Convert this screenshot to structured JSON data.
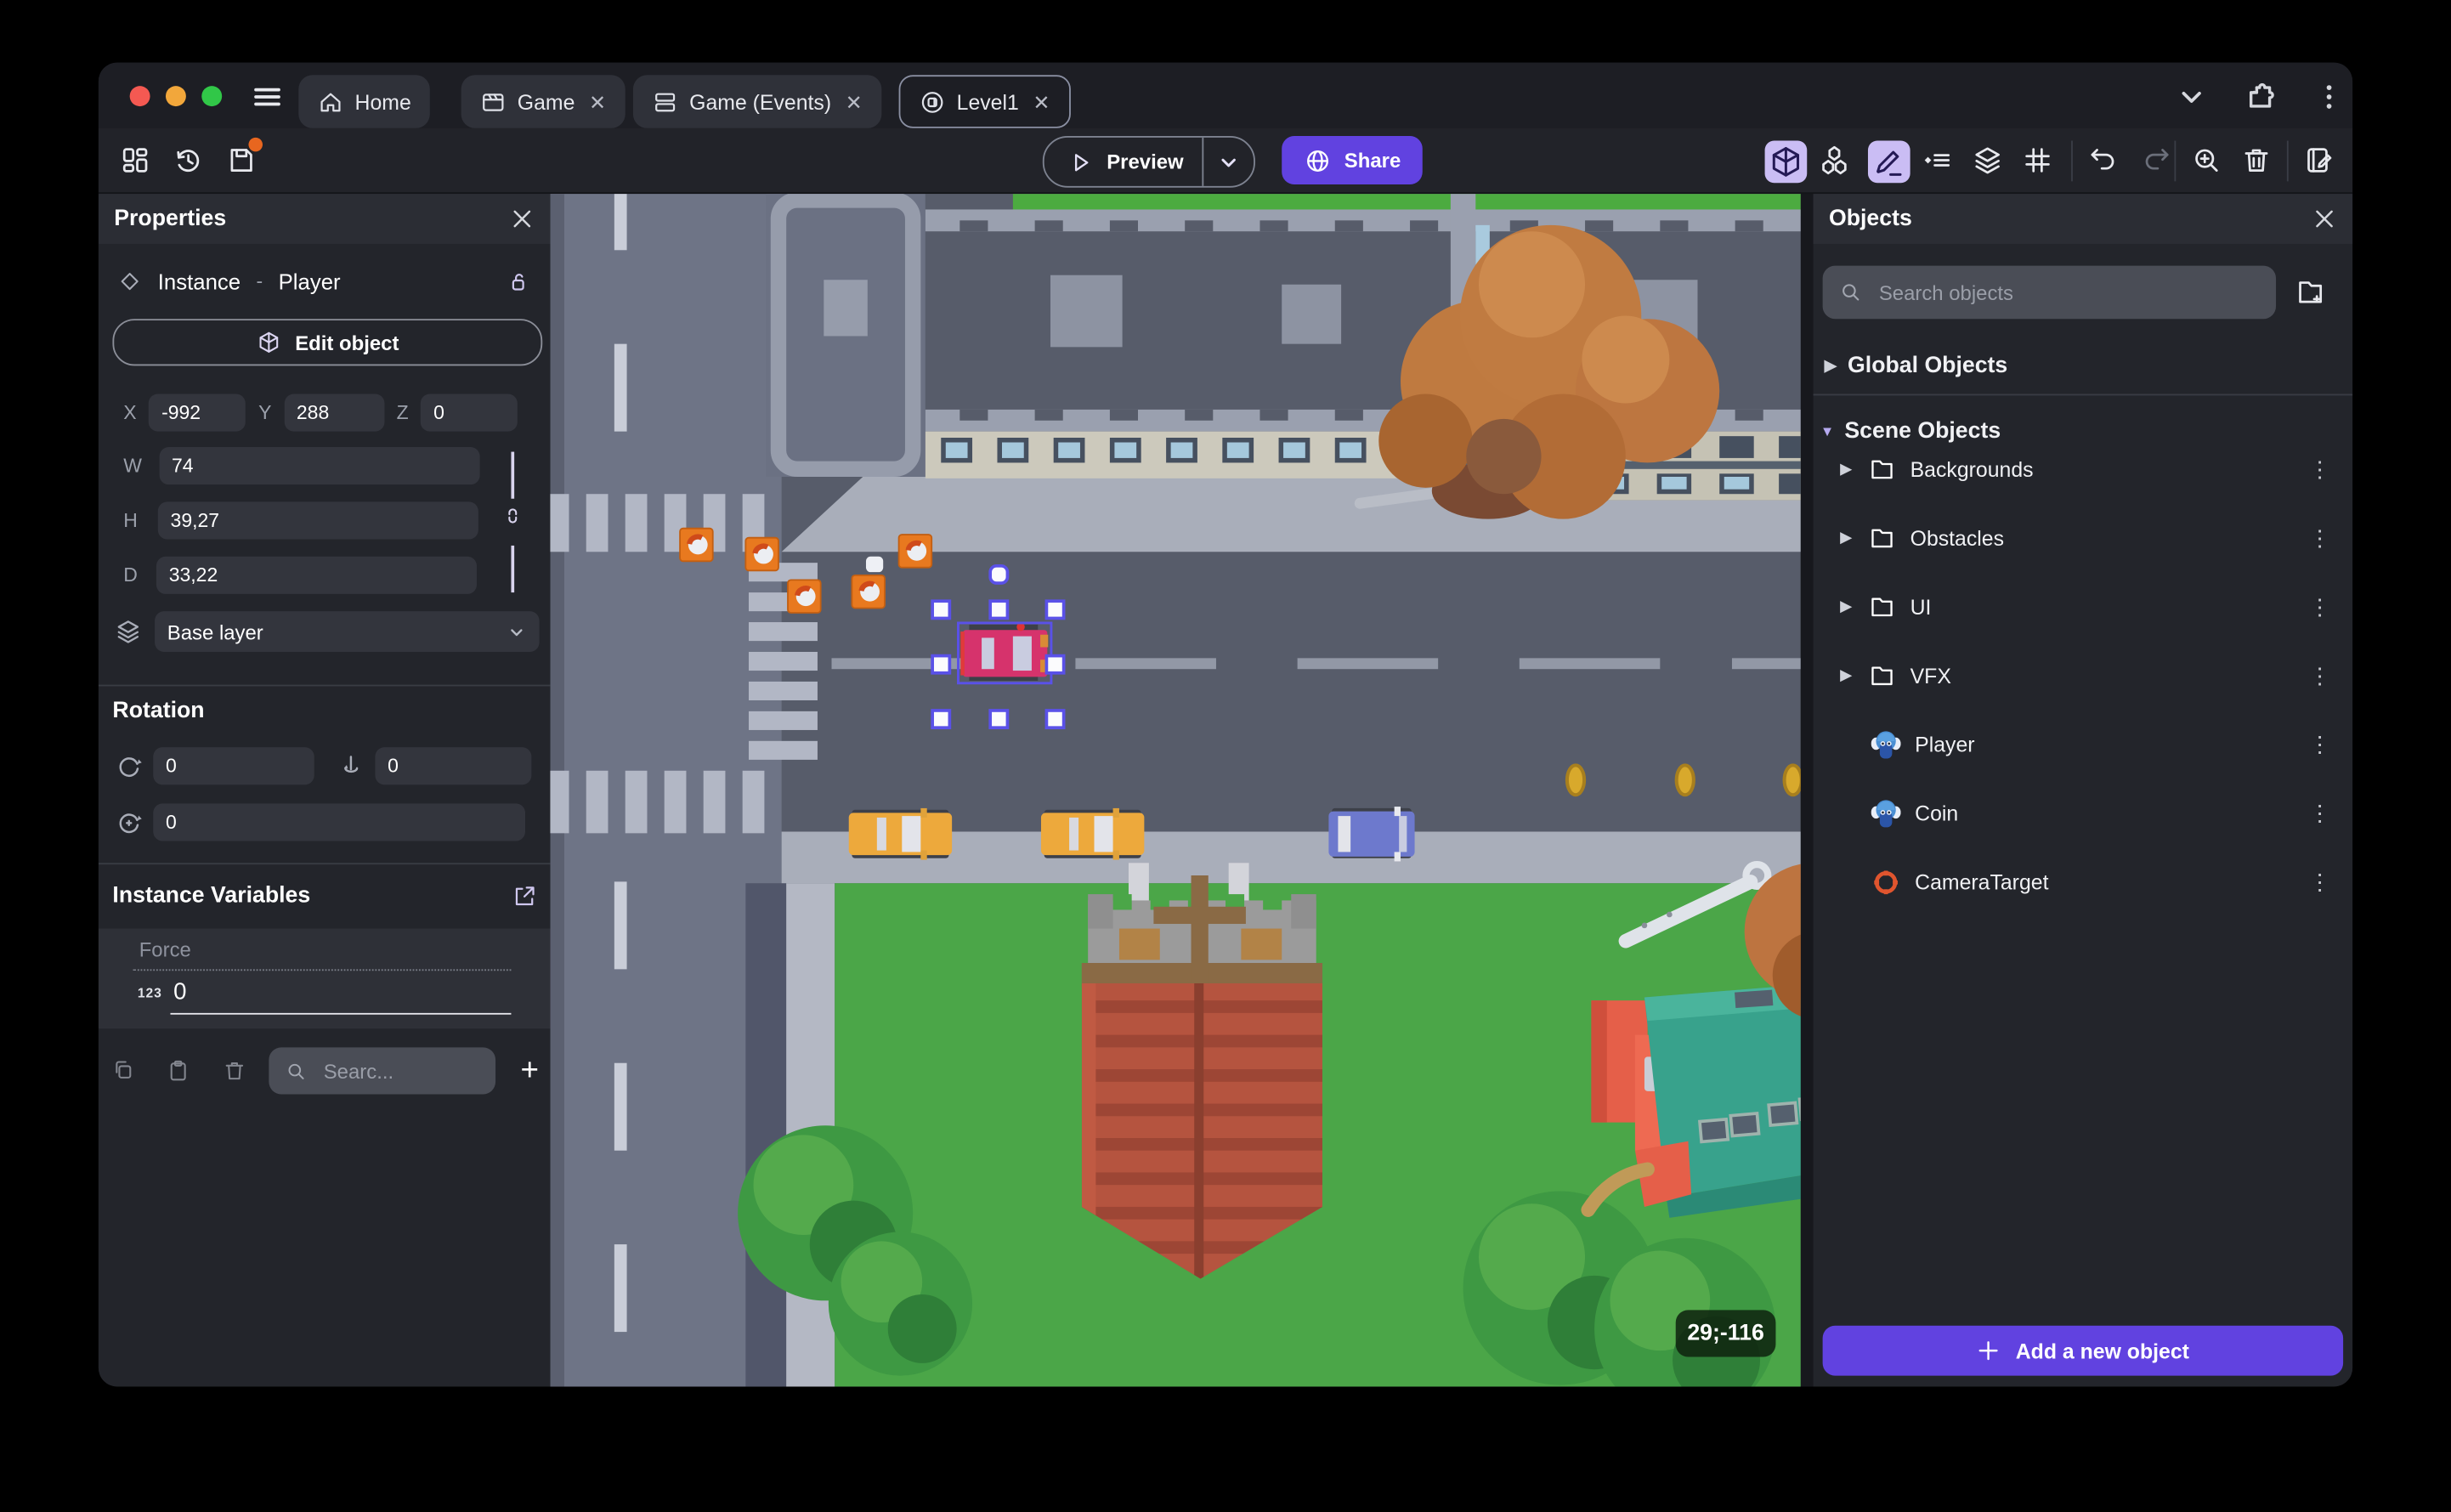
{
  "colors": {
    "accent": "#6142e0",
    "accent_light": "#cabdf4",
    "traffic_red": "#f45952",
    "traffic_yellow": "#f2a73b",
    "traffic_green": "#31c748",
    "save_badge": "#e8661f",
    "selection": "#5a51e8",
    "camera_target_icon": "#e0552e"
  },
  "titlebar": {
    "tabs": [
      {
        "label": "Home",
        "icon": "home-icon",
        "active": false,
        "closable": false
      },
      {
        "label": "Game",
        "icon": "clapper-icon",
        "active": false,
        "closable": true
      },
      {
        "label": "Game (Events)",
        "icon": "events-icon",
        "active": false,
        "closable": true
      },
      {
        "label": "Level1",
        "icon": "scene-icon",
        "active": true,
        "closable": true
      }
    ],
    "close_glyph": "✕"
  },
  "toolbar": {
    "preview_label": "Preview",
    "share_label": "Share",
    "left_icons": [
      "dashboard-icon",
      "history-icon",
      "save-icon"
    ],
    "right_icons": [
      "cube-3d-icon",
      "objects-icon",
      "pencil-icon",
      "instances-list-icon",
      "layers-icon",
      "grid-icon",
      "undo-icon",
      "redo-icon",
      "zoom-in-icon",
      "trash-icon",
      "notebook-edit-icon"
    ]
  },
  "properties": {
    "title": "Properties",
    "instance_type": "Instance",
    "separator": "-",
    "instance_name": "Player",
    "edit_object": "Edit object",
    "x_label": "X",
    "x": "-992",
    "y_label": "Y",
    "y": "288",
    "z_label": "Z",
    "z": "0",
    "w_label": "W",
    "w": "74",
    "h_label": "H",
    "h": "39,27",
    "d_label": "D",
    "d": "33,22",
    "layer": "Base layer",
    "rotation_title": "Rotation",
    "rot_x": "0",
    "rot_y": "0",
    "rot_z": "0",
    "variables_title": "Instance Variables",
    "var_name": "Force",
    "var_type": "123",
    "var_value": "0",
    "search_placeholder": "Searc...",
    "add_glyph": "+"
  },
  "objects_panel": {
    "title": "Objects",
    "search_placeholder": "Search objects",
    "global_group": "Global Objects",
    "scene_group": "Scene Objects",
    "folders": [
      {
        "label": "Backgrounds"
      },
      {
        "label": "Obstacles"
      },
      {
        "label": "UI"
      },
      {
        "label": "VFX"
      }
    ],
    "items": [
      {
        "label": "Player",
        "icon": "monkey-icon"
      },
      {
        "label": "Coin",
        "icon": "monkey-icon"
      },
      {
        "label": "CameraTarget",
        "icon": "target-icon"
      }
    ],
    "add_button": "Add a new object",
    "kebab_glyph": "⋮",
    "collapsed_glyph": "▶",
    "expanded_glyph": "▼"
  },
  "scene": {
    "coordinate_badge": "29;-116",
    "selected_instance": "Player",
    "visible_objects": [
      "city-building",
      "roads",
      "crosswalks",
      "orange-crates",
      "player-car-selected",
      "taxi-cars",
      "blue-car",
      "coins",
      "autumn-tree",
      "church-tower",
      "teal-roof-house",
      "green-trees",
      "skeleton-arm"
    ]
  }
}
